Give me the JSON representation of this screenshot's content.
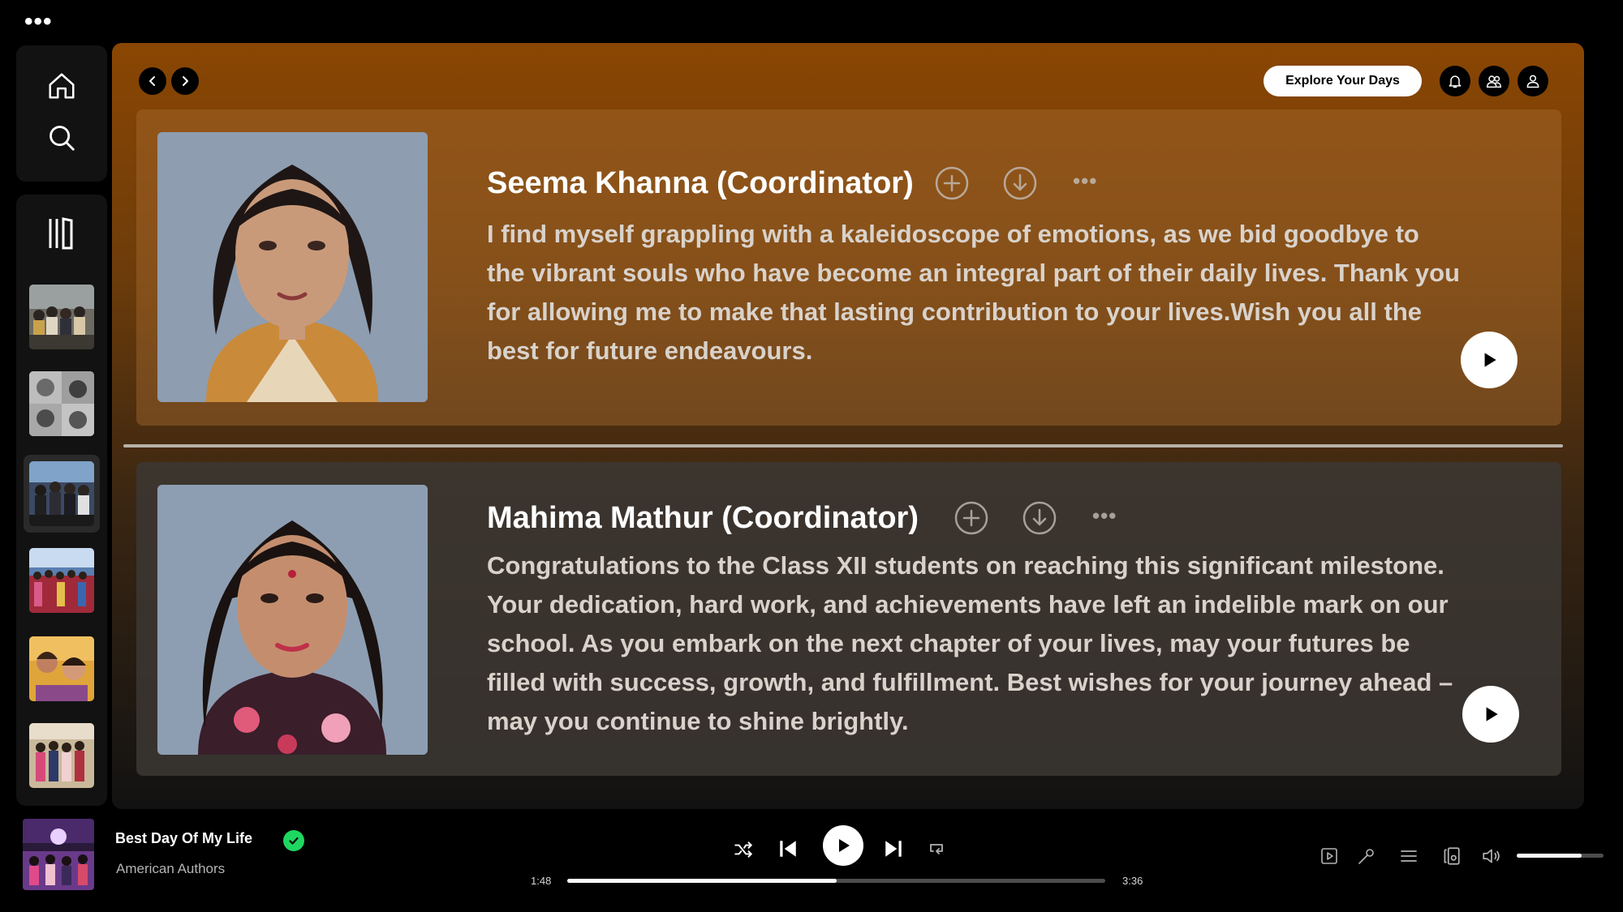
{
  "window": {
    "menu_glyph": "•••"
  },
  "sidebar": {
    "nav": [
      {
        "name": "home",
        "icon": "home-icon"
      },
      {
        "name": "search",
        "icon": "search-icon"
      }
    ],
    "library_icon": "library-icon",
    "playlists": [
      {
        "name": "group-photo-1"
      },
      {
        "name": "collage-bw"
      },
      {
        "name": "group-photo-2",
        "active": true
      },
      {
        "name": "group-photo-3"
      },
      {
        "name": "selfie"
      },
      {
        "name": "group-photo-4"
      }
    ]
  },
  "header": {
    "explore_label": "Explore Your Days",
    "icons": [
      "bell-icon",
      "friends-icon",
      "user-icon"
    ]
  },
  "cards": [
    {
      "name": "Seema Khanna (Coordinator)",
      "message": "I find myself grappling with a kaleidoscope of emotions, as we bid goodbye to the vibrant souls who have become an integral part of their daily lives. Thank you for allowing me to make that lasting contribution to your lives.Wish you all the best for future endeavours.",
      "more_glyph": "•••"
    },
    {
      "name": "Mahima Mathur (Coordinator)",
      "message": "Congratulations to the Class XII students on reaching this significant milestone. Your dedication, hard work, and achievements have left an indelible mark on our school. As you embark on the next chapter of your lives, may your futures be filled with success, growth, and fulfillment. Best wishes for your journey ahead – may you continue to shine brightly.",
      "more_glyph": "•••"
    }
  ],
  "player": {
    "title": "Best Day Of My Life",
    "artist": "American Authors",
    "elapsed": "1:48",
    "duration": "3:36",
    "progress_fraction": 0.5,
    "volume_fraction": 0.75,
    "accent": "#1ed760"
  }
}
